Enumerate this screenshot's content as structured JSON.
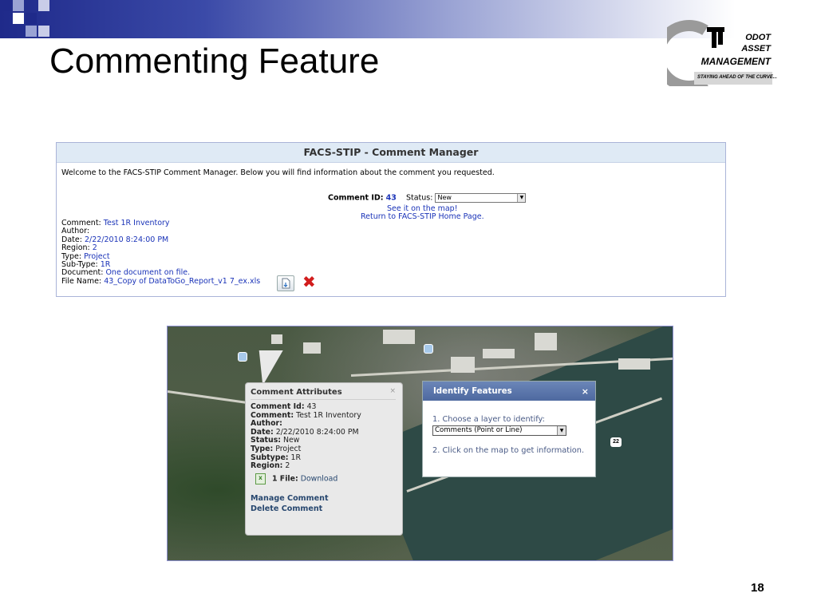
{
  "slide": {
    "title": "Commenting Feature",
    "page_number": "18"
  },
  "logo": {
    "line1": "ODOT",
    "line2": "ASSET",
    "line3": "MANAGEMENT",
    "tagline": "STAYING AHEAD OF THE CURVE..."
  },
  "comment_manager": {
    "header": "FACS-STIP - Comment Manager",
    "welcome": "Welcome to the FACS-STIP Comment Manager. Below you will find information about the comment you requested.",
    "comment_id_label": "Comment ID:",
    "comment_id_value": "43",
    "status_label": "Status:",
    "status_value": "New",
    "see_on_map": "See it on the map!",
    "return_home": "Return to FACS-STIP Home Page.",
    "fields": [
      {
        "label": "Comment:",
        "value": "Test 1R Inventory"
      },
      {
        "label": "Author:",
        "value": ""
      },
      {
        "label": "Date:",
        "value": "2/22/2010 8:24:00 PM"
      },
      {
        "label": "Region:",
        "value": "2"
      },
      {
        "label": "Type:",
        "value": "Project"
      },
      {
        "label": "Sub-Type:",
        "value": "1R"
      },
      {
        "label": "Document:",
        "value": "One document on file."
      },
      {
        "label": "File Name:",
        "value": "43_Copy of DataToGo_Report_v1 7_ex.xls"
      }
    ]
  },
  "map": {
    "route_shield": "22",
    "popup": {
      "title": "Comment Attributes",
      "close": "×",
      "fields": [
        {
          "label": "Comment Id:",
          "value": "43"
        },
        {
          "label": "Comment:",
          "value": "Test 1R Inventory"
        },
        {
          "label": "Author:",
          "value": ""
        },
        {
          "label": "Date:",
          "value": "2/22/2010 8:24:00 PM"
        },
        {
          "label": "Status:",
          "value": "New"
        },
        {
          "label": "Type:",
          "value": "Project"
        },
        {
          "label": "Subtype:",
          "value": "1R"
        },
        {
          "label": "Region:",
          "value": "2"
        }
      ],
      "file_label": "1 File:",
      "file_link": "Download",
      "manage_link": "Manage Comment",
      "delete_link": "Delete Comment"
    },
    "identify": {
      "title": "Identify Features",
      "close": "×",
      "step1": "1. Choose a layer to identify:",
      "layer_value": "Comments (Point or Line)",
      "step2": "2. Click on the map to get information."
    }
  },
  "colors": {
    "link_blue": "#1a33b8",
    "panel_header_bg": "#dfeaf5",
    "delete_red": "#d21d1d",
    "identify_header": "#5a75aa"
  }
}
